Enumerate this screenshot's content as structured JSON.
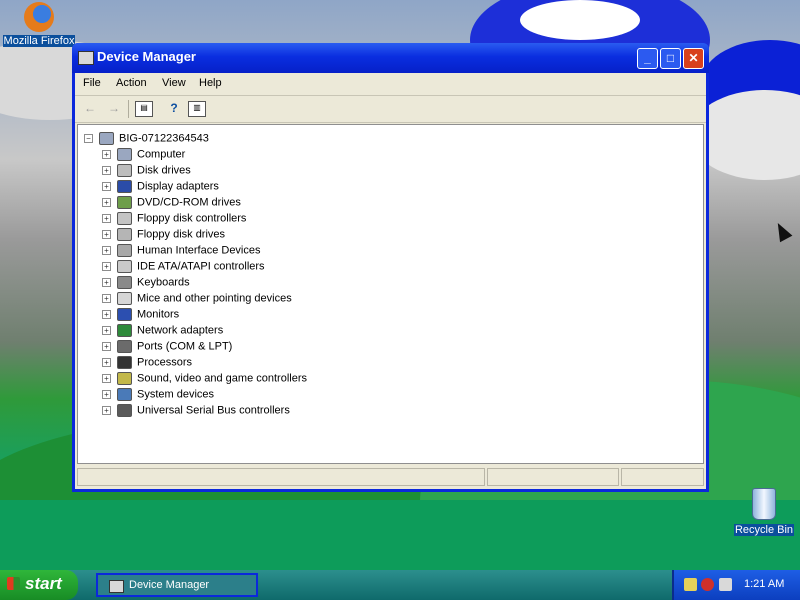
{
  "desktop": {
    "icons": [
      {
        "label": "Mozilla Firefox",
        "icon": "firefox-icon"
      },
      {
        "label": "Recycle Bin",
        "icon": "recycle-bin-icon"
      }
    ]
  },
  "window": {
    "title": "Device Manager",
    "controls": {
      "minimize": "_",
      "maximize": "□",
      "close": "✕"
    },
    "menu": [
      "File",
      "Action",
      "View",
      "Help"
    ],
    "toolbar": {
      "back": "←",
      "forward": "→",
      "tree": "▤",
      "properties": "?",
      "list": "▥"
    },
    "tree": {
      "root": {
        "label": "BIG-07122364543",
        "expander": "−",
        "icon": "computer-icon"
      },
      "items": [
        {
          "label": "Computer",
          "icon": "computer-icon",
          "color": "#9aa7c0"
        },
        {
          "label": "Disk drives",
          "icon": "disk-drive-icon",
          "color": "#bdbdbd"
        },
        {
          "label": "Display adapters",
          "icon": "display-adapter-icon",
          "color": "#2b4ca8"
        },
        {
          "label": "DVD/CD-ROM drives",
          "icon": "dvd-drive-icon",
          "color": "#6e9e4a"
        },
        {
          "label": "Floppy disk controllers",
          "icon": "floppy-controller-icon",
          "color": "#c4c4c4"
        },
        {
          "label": "Floppy disk drives",
          "icon": "floppy-drive-icon",
          "color": "#b5b5b5"
        },
        {
          "label": "Human Interface Devices",
          "icon": "hid-icon",
          "color": "#a8a8a8"
        },
        {
          "label": "IDE ATA/ATAPI controllers",
          "icon": "ide-controller-icon",
          "color": "#c9c9c9"
        },
        {
          "label": "Keyboards",
          "icon": "keyboard-icon",
          "color": "#8a8a8a"
        },
        {
          "label": "Mice and other pointing devices",
          "icon": "mouse-icon",
          "color": "#d6d6d6"
        },
        {
          "label": "Monitors",
          "icon": "monitor-icon",
          "color": "#2c4fb0"
        },
        {
          "label": "Network adapters",
          "icon": "network-adapter-icon",
          "color": "#2e8a3a"
        },
        {
          "label": "Ports (COM & LPT)",
          "icon": "port-icon",
          "color": "#6b6b6b"
        },
        {
          "label": "Processors",
          "icon": "processor-icon",
          "color": "#333333"
        },
        {
          "label": "Sound, video and game controllers",
          "icon": "sound-icon",
          "color": "#c2b84a"
        },
        {
          "label": "System devices",
          "icon": "system-device-icon",
          "color": "#4a7ab8"
        },
        {
          "label": "Universal Serial Bus controllers",
          "icon": "usb-icon",
          "color": "#5a5a5a"
        }
      ],
      "expander": "+"
    }
  },
  "taskbar": {
    "start_label": "start",
    "task_label": "Device Manager",
    "clock": "1:21 AM",
    "tray_icons": [
      "tray-user-icon",
      "tray-security-icon",
      "tray-network-icon"
    ]
  }
}
